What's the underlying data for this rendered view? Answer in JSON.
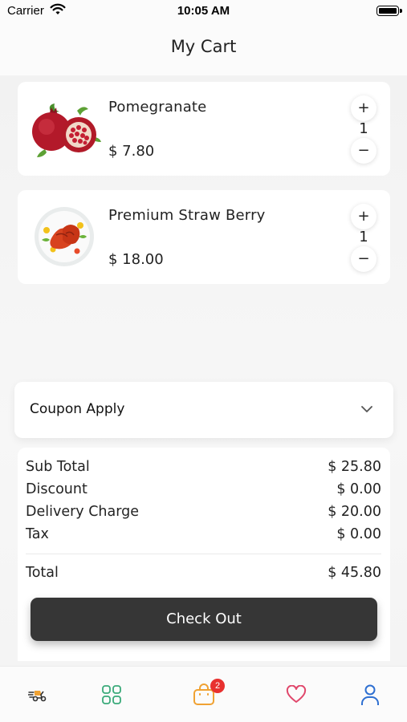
{
  "status_bar": {
    "carrier": "Carrier",
    "time": "10:05 AM"
  },
  "header": {
    "title": "My Cart"
  },
  "cart_items": [
    {
      "name": "Pomegranate",
      "price": "$ 7.80",
      "quantity": "1",
      "plus": "+",
      "minus": "−"
    },
    {
      "name": "Premium Straw Berry",
      "price": "$ 18.00",
      "quantity": "1",
      "plus": "+",
      "minus": "−"
    }
  ],
  "coupon": {
    "label": "Coupon Apply"
  },
  "summary": {
    "rows": [
      {
        "label": "Sub Total",
        "value": "$ 25.80"
      },
      {
        "label": "Discount",
        "value": "$ 0.00"
      },
      {
        "label": "Delivery Charge",
        "value": "$ 20.00"
      },
      {
        "label": "Tax",
        "value": "$ 0.00"
      }
    ],
    "total": {
      "label": "Total",
      "value": "$ 45.80"
    }
  },
  "checkout": {
    "label": "Check Out"
  },
  "tab_bar": {
    "tabs": [
      {
        "icon": "delivery-scooter-icon",
        "color": "#333333"
      },
      {
        "icon": "categories-grid-icon",
        "color": "#3aaa7a"
      },
      {
        "icon": "cart-bag-icon",
        "color": "#f0a233"
      },
      {
        "icon": "heart-icon",
        "color": "#e0476b"
      },
      {
        "icon": "profile-icon",
        "color": "#2e6fd1"
      }
    ],
    "cart_badge": "2"
  }
}
